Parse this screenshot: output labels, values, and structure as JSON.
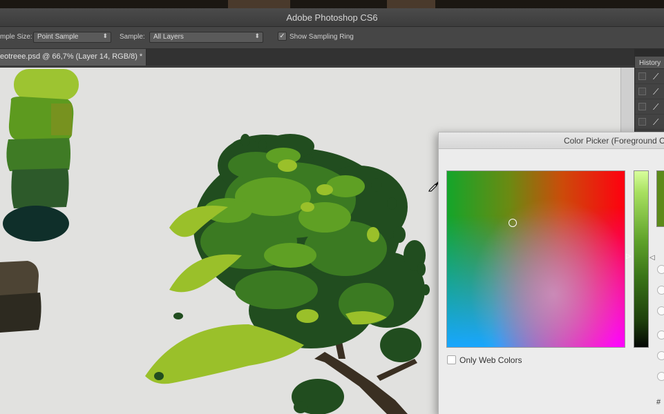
{
  "window": {
    "title": "Adobe Photoshop CS6"
  },
  "options": {
    "sample_size_label": "mple Size:",
    "sample_size_value": "Point Sample",
    "sample_label": "Sample:",
    "sample_value": "All Layers",
    "show_sampling_ring_label": "Show Sampling Ring",
    "show_sampling_ring_checked": true
  },
  "document": {
    "tab_label": "eotreee.psd @ 66,7% (Layer 14, RGB/8) *"
  },
  "history_panel": {
    "title": "History",
    "rows": 4
  },
  "color_picker": {
    "title": "Color Picker (Foreground Color)",
    "only_web_colors_label": "Only Web Colors",
    "hash_label": "#",
    "selected_color": "#5c8a1a"
  },
  "palette": {
    "greens": [
      "#9dc431",
      "#5d9a1f",
      "#3f7b25",
      "#2d5a2a",
      "#0f2f2a"
    ],
    "browns": [
      "#4d4434",
      "#2d2a20"
    ]
  },
  "tree_colors": [
    "#214d1f",
    "#3b7a22",
    "#5fa024",
    "#9ac02a",
    "#3a2f22"
  ]
}
